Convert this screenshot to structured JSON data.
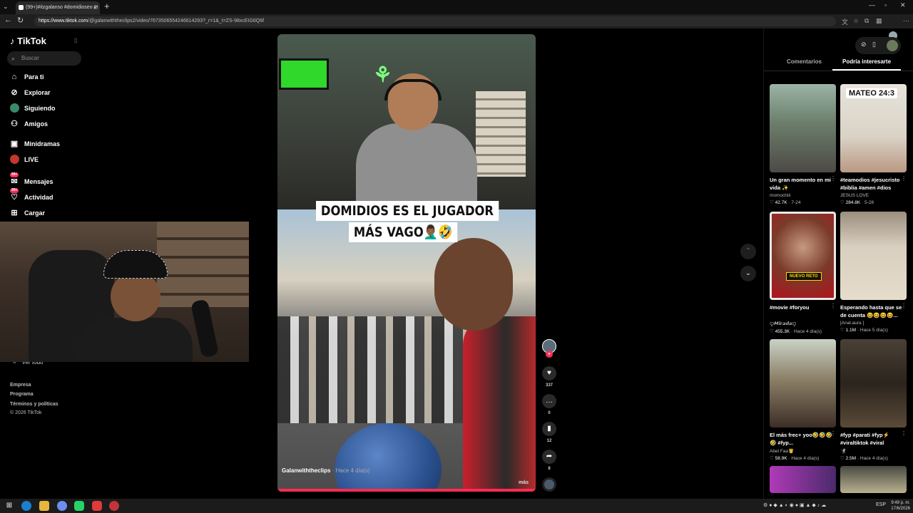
{
  "browser": {
    "tab_title": "(99+)#itzgalanso #domidioseo #t",
    "url_host": "https://www.tiktok.com",
    "url_path": "/@galanwiththeclips2/video/7673506554246614293?_r=1&_t=ZS-98xcEIG6Q6f"
  },
  "sidebar": {
    "logo": "TikTok",
    "search_placeholder": "Buscar",
    "items": [
      {
        "label": "Para ti",
        "icon": "home-icon"
      },
      {
        "label": "Explorar",
        "icon": "compass-icon"
      },
      {
        "label": "Siguiendo",
        "icon": "following-icon"
      },
      {
        "label": "Amigos",
        "icon": "friends-icon"
      },
      {
        "label": "Minidramas",
        "icon": "minidramas-icon"
      },
      {
        "label": "LIVE",
        "icon": "live-icon"
      },
      {
        "label": "Mensajes",
        "icon": "messages-icon",
        "badge": "99+"
      },
      {
        "label": "Actividad",
        "icon": "activity-icon",
        "badge": "99+"
      },
      {
        "label": "Cargar",
        "icon": "upload-icon"
      }
    ],
    "ver_todo": "Ver todo",
    "footer": [
      "Empresa",
      "Programa",
      "Términos y políticas",
      "© 2026 TikTok"
    ]
  },
  "video": {
    "caption_line1": "DOMIDIOS ES EL JUGADOR",
    "caption_line2": "MÁS VAGO🤦🏾‍♂️🤣",
    "author": "Galanwiththeclips",
    "time": "· Hace 4 día(s)",
    "more": "más",
    "progress_fraction": 1.0
  },
  "actions": {
    "likes": "337",
    "comments": "0",
    "saves": "12",
    "shares": "8"
  },
  "right_panel": {
    "tabs": [
      "Comentarios",
      "Podría interesarte"
    ],
    "active_tab": 1,
    "cards": [
      {
        "title": "Un gran momento en mi vida ✨",
        "author": "momochiii",
        "views": "42.7K",
        "date": "7-24",
        "overlay": ""
      },
      {
        "title": "#teamodios #jesucristo #biblia #amen #dios",
        "author": "JESUS LOVE",
        "views": "284.8K",
        "date": "5-28",
        "overlay": "MATEO 24:3"
      },
      {
        "title": "#movie #foryou",
        "author": "ꨄ𝙈𝙞𝙧𝙖𝙙𝙖ꨄ",
        "views": "455.3K",
        "date": "Hace 4 día(s)",
        "overlay": "NUEVO RETO"
      },
      {
        "title": "Esperando hasta que se de cuenta 😆😆😆😆...",
        "author": "[Anal.aura ]",
        "views": "1.1M",
        "date": "Hace 5 día(s)",
        "overlay": ""
      },
      {
        "title": "El más frec+ yoo🤣🤣🤣🤣 #fyp...",
        "author": "Abel Faa🤴",
        "views": "58.9K",
        "date": "Hace 4 día(s)",
        "overlay": ""
      },
      {
        "title": "#fyp #parati #fyp⚡ #viraltiktok #viral",
        "author": "🤺",
        "views": "2.5M",
        "date": "Hace 4 día(s)",
        "overlay": ""
      }
    ]
  },
  "taskbar": {
    "time": "9:49 p. m.",
    "date": "17/6/2026",
    "lang": "ESP"
  },
  "colors": {
    "accent": "#fe2c55",
    "background": "#000000"
  }
}
